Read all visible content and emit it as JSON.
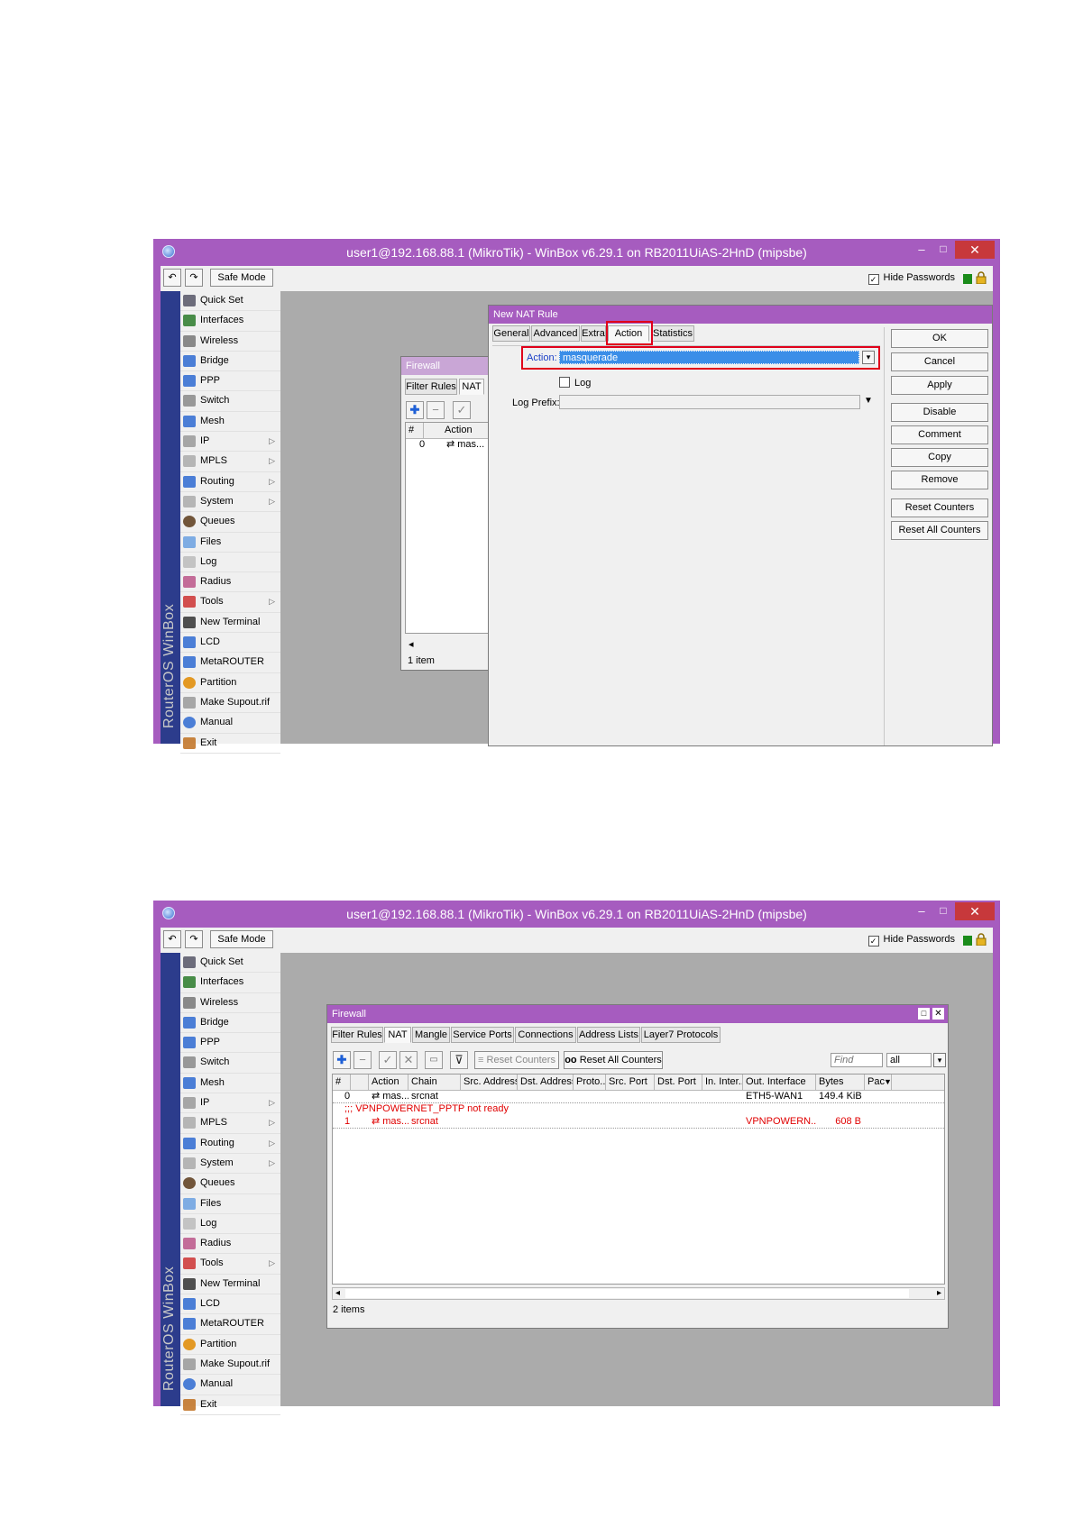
{
  "window": {
    "title": "user1@192.168.88.1 (MikroTik) - WinBox v6.29.1 on RB2011UiAS-2HnD (mipsbe)",
    "minimize": "–",
    "maximize": "□",
    "close": "✕"
  },
  "toolbar": {
    "undo": "↶",
    "redo": "↷",
    "safe_mode": "Safe Mode",
    "hide_passwords_label": "Hide Passwords",
    "hide_passwords_checked": "✓"
  },
  "brand": "RouterOS WinBox",
  "menu": [
    {
      "label": "Quick Set",
      "icon": "quick-set-icon",
      "arrow": ""
    },
    {
      "label": "Interfaces",
      "icon": "interfaces-icon",
      "arrow": ""
    },
    {
      "label": "Wireless",
      "icon": "wireless-icon",
      "arrow": ""
    },
    {
      "label": "Bridge",
      "icon": "bridge-icon",
      "arrow": ""
    },
    {
      "label": "PPP",
      "icon": "ppp-icon",
      "arrow": ""
    },
    {
      "label": "Switch",
      "icon": "switch-icon",
      "arrow": ""
    },
    {
      "label": "Mesh",
      "icon": "mesh-icon",
      "arrow": ""
    },
    {
      "label": "IP",
      "icon": "ip-icon",
      "arrow": "▷"
    },
    {
      "label": "MPLS",
      "icon": "mpls-icon",
      "arrow": "▷"
    },
    {
      "label": "Routing",
      "icon": "routing-icon",
      "arrow": "▷"
    },
    {
      "label": "System",
      "icon": "system-icon",
      "arrow": "▷"
    },
    {
      "label": "Queues",
      "icon": "queues-icon",
      "arrow": ""
    },
    {
      "label": "Files",
      "icon": "files-icon",
      "arrow": ""
    },
    {
      "label": "Log",
      "icon": "log-icon",
      "arrow": ""
    },
    {
      "label": "Radius",
      "icon": "radius-icon",
      "arrow": ""
    },
    {
      "label": "Tools",
      "icon": "tools-icon",
      "arrow": "▷"
    },
    {
      "label": "New Terminal",
      "icon": "terminal-icon",
      "arrow": ""
    },
    {
      "label": "LCD",
      "icon": "lcd-icon",
      "arrow": ""
    },
    {
      "label": "MetaROUTER",
      "icon": "metarouter-icon",
      "arrow": ""
    },
    {
      "label": "Partition",
      "icon": "partition-icon",
      "arrow": ""
    },
    {
      "label": "Make Supout.rif",
      "icon": "supout-icon",
      "arrow": ""
    },
    {
      "label": "Manual",
      "icon": "manual-icon",
      "arrow": ""
    },
    {
      "label": "Exit",
      "icon": "exit-icon",
      "arrow": ""
    }
  ],
  "shot1": {
    "firewall_bg": {
      "title": "Firewall",
      "tabs": [
        "Filter Rules",
        "NAT"
      ],
      "col_num": "#",
      "col_action": "Action",
      "row_num": "0",
      "row_action": "⇄ mas...",
      "scroll_left": "◂",
      "status": "1 item"
    },
    "nat_rule": {
      "title": "New NAT Rule",
      "tabs": [
        "General",
        "Advanced",
        "Extra",
        "Action",
        "Statistics"
      ],
      "action_label": "Action:",
      "action_value": "masquerade",
      "log_label": "Log",
      "log_prefix_label": "Log Prefix:",
      "log_prefix_value": "",
      "buttons": [
        "OK",
        "Cancel",
        "Apply",
        "Disable",
        "Comment",
        "Copy",
        "Remove",
        "Reset Counters",
        "Reset All Counters"
      ]
    }
  },
  "shot2": {
    "firewall": {
      "title": "Firewall",
      "tabs": [
        "Filter Rules",
        "NAT",
        "Mangle",
        "Service Ports",
        "Connections",
        "Address Lists",
        "Layer7 Protocols"
      ],
      "reset_counters": "Reset Counters",
      "reset_all_counters": "Reset All Counters",
      "find_placeholder": "Find",
      "filter_value": "all",
      "columns": [
        "#",
        "",
        "Action",
        "Chain",
        "Src. Address",
        "Dst. Address",
        "Proto...",
        "Src. Port",
        "Dst. Port",
        "In. Inter...",
        "Out. Interface",
        "Bytes",
        "Pac"
      ],
      "rows": [
        {
          "num": "0",
          "action": "⇄ mas...",
          "chain": "srcnat",
          "out_interface": "ETH5-WAN1",
          "bytes": "149.4 KiB",
          "red": false
        },
        {
          "num": "1",
          "action": "⇄ mas...",
          "chain": "srcnat",
          "out_interface": "VPNPOWERN...",
          "bytes": "608 B",
          "red": true
        }
      ],
      "comment": ";;; VPNPOWERNET_PPTP not ready",
      "scroll_left": "◂",
      "scroll_right": "▸",
      "status": "2 items"
    }
  },
  "colors": {
    "title_purple": "#a65cbf",
    "brand_blue": "#2c3c8c",
    "highlight_red": "#e0001a",
    "selection_blue": "#3b8ee8"
  }
}
